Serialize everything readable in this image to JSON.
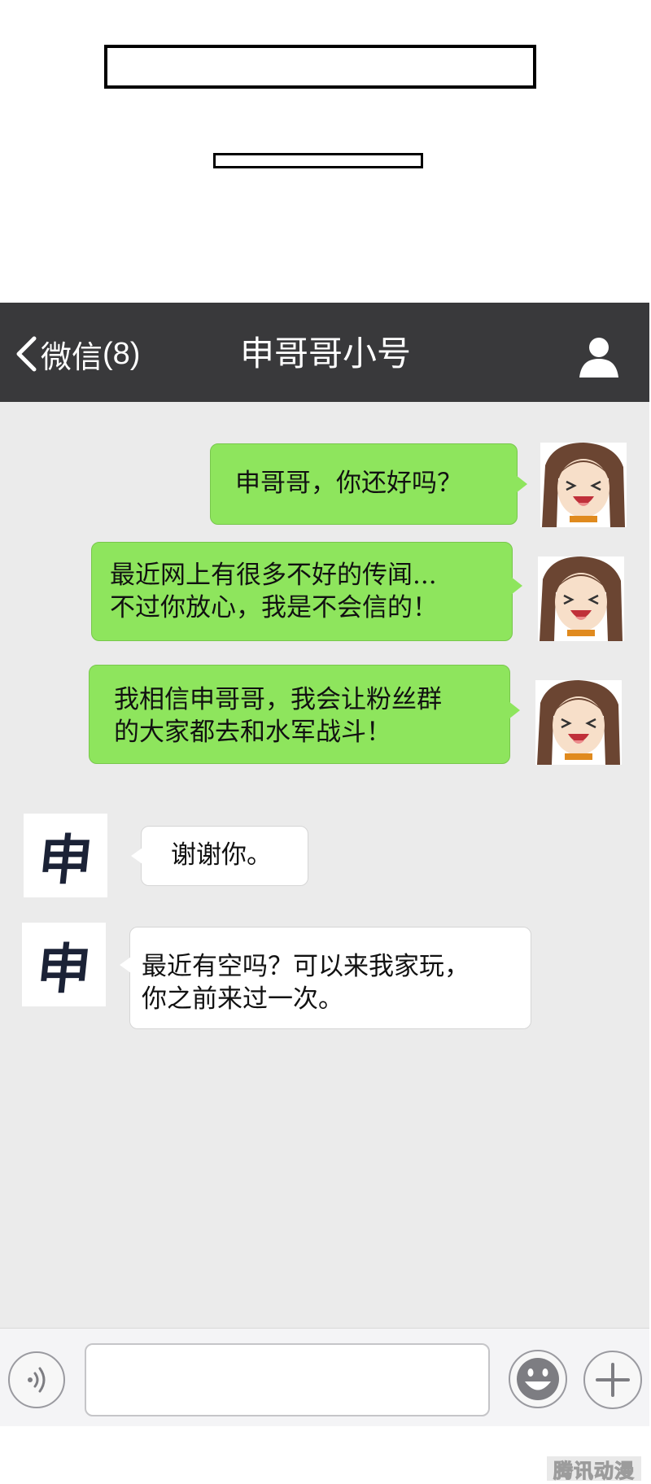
{
  "header": {
    "back_label": "微信",
    "unread_count": "(8)",
    "title": "申哥哥小号"
  },
  "messages": [
    {
      "side": "right",
      "lines": [
        "申哥哥，你还好吗？"
      ]
    },
    {
      "side": "right",
      "lines": [
        "最近网上有很多不好的传闻...",
        "不过你放心，我是不会信的！"
      ]
    },
    {
      "side": "right",
      "lines": [
        "我相信申哥哥，我会让粉丝群",
        "的大家都去和水军战斗！"
      ]
    },
    {
      "side": "left",
      "lines": [
        "谢谢你。"
      ]
    },
    {
      "side": "left",
      "lines": [
        "最近有空吗？可以来我家玩，",
        "你之前来过一次。"
      ]
    }
  ],
  "contact_avatar_char": "申",
  "input": {
    "placeholder": ""
  },
  "icons": {
    "back": "chevron-left-icon",
    "profile": "person-icon",
    "voice": "voice-icon",
    "emoji": "emoji-icon",
    "add": "plus-icon"
  },
  "colors": {
    "navbar": "#39393b",
    "chat_bg": "#ebebeb",
    "green_bubble": "#8ee55d",
    "white_bubble": "#ffffff"
  },
  "watermark": "腾讯动漫"
}
